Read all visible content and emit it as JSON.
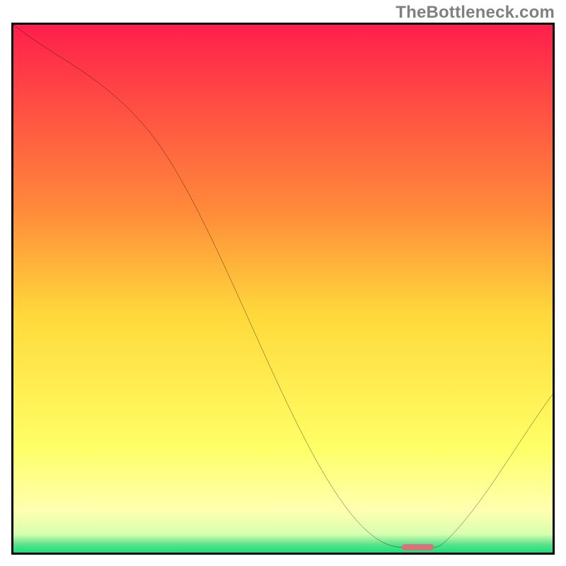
{
  "watermark": "TheBottleneck.com",
  "chart_data": {
    "type": "line",
    "title": "",
    "xlabel": "",
    "ylabel": "",
    "xlim": [
      0,
      100
    ],
    "ylim": [
      0,
      100
    ],
    "series": [
      {
        "name": "curve",
        "x": [
          0,
          25,
          72,
          78,
          80,
          100
        ],
        "y": [
          100,
          80,
          1,
          1,
          2,
          30
        ]
      }
    ],
    "marker": {
      "name": "optimal-region",
      "x_start": 72,
      "x_end": 78,
      "y": 1,
      "color": "#d9717d"
    },
    "background_gradient": {
      "stops": [
        {
          "offset": 0.0,
          "color": "#ff1f4b"
        },
        {
          "offset": 0.35,
          "color": "#ff8a3a"
        },
        {
          "offset": 0.55,
          "color": "#ffd93b"
        },
        {
          "offset": 0.8,
          "color": "#ffff66"
        },
        {
          "offset": 0.92,
          "color": "#ffffb0"
        },
        {
          "offset": 0.965,
          "color": "#d8ffb0"
        },
        {
          "offset": 0.985,
          "color": "#59e28a"
        },
        {
          "offset": 1.0,
          "color": "#19e07a"
        }
      ]
    }
  }
}
